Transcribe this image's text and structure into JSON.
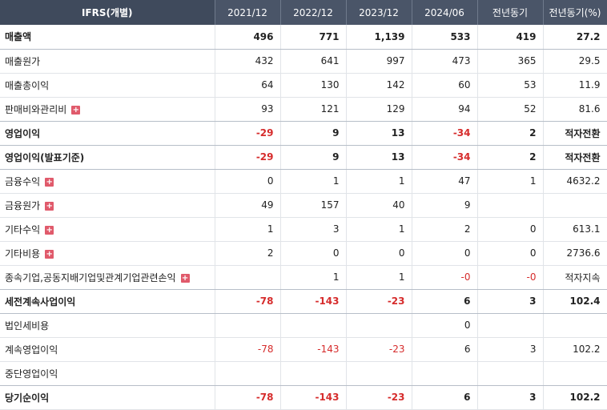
{
  "header": [
    "IFRS(개별)",
    "2021/12",
    "2022/12",
    "2023/12",
    "2024/06",
    "전년동기",
    "전년동기(%)"
  ],
  "rows": [
    {
      "label": "매출액",
      "bold": true,
      "expand": false,
      "cells": [
        "496",
        "771",
        "1,139",
        "533",
        "419",
        "27.2"
      ],
      "neg": [
        false,
        false,
        false,
        false,
        false,
        false
      ]
    },
    {
      "label": "매출원가",
      "bold": false,
      "expand": false,
      "cells": [
        "432",
        "641",
        "997",
        "473",
        "365",
        "29.5"
      ],
      "neg": [
        false,
        false,
        false,
        false,
        false,
        false
      ]
    },
    {
      "label": "매출총이익",
      "bold": false,
      "expand": false,
      "cells": [
        "64",
        "130",
        "142",
        "60",
        "53",
        "11.9"
      ],
      "neg": [
        false,
        false,
        false,
        false,
        false,
        false
      ]
    },
    {
      "label": "판매비와관리비",
      "bold": false,
      "expand": true,
      "cells": [
        "93",
        "121",
        "129",
        "94",
        "52",
        "81.6"
      ],
      "neg": [
        false,
        false,
        false,
        false,
        false,
        false
      ]
    },
    {
      "label": "영업이익",
      "bold": true,
      "expand": false,
      "cells": [
        "-29",
        "9",
        "13",
        "-34",
        "2",
        "적자전환"
      ],
      "neg": [
        true,
        false,
        false,
        true,
        false,
        false
      ]
    },
    {
      "label": "영업이익(발표기준)",
      "bold": true,
      "expand": false,
      "cells": [
        "-29",
        "9",
        "13",
        "-34",
        "2",
        "적자전환"
      ],
      "neg": [
        true,
        false,
        false,
        true,
        false,
        false
      ]
    },
    {
      "label": "금융수익",
      "bold": false,
      "expand": true,
      "cells": [
        "0",
        "1",
        "1",
        "47",
        "1",
        "4632.2"
      ],
      "neg": [
        false,
        false,
        false,
        false,
        false,
        false
      ]
    },
    {
      "label": "금융원가",
      "bold": false,
      "expand": true,
      "cells": [
        "49",
        "157",
        "40",
        "9",
        "",
        ""
      ],
      "neg": [
        false,
        false,
        false,
        false,
        false,
        false
      ]
    },
    {
      "label": "기타수익",
      "bold": false,
      "expand": true,
      "cells": [
        "1",
        "3",
        "1",
        "2",
        "0",
        "613.1"
      ],
      "neg": [
        false,
        false,
        false,
        false,
        false,
        false
      ]
    },
    {
      "label": "기타비용",
      "bold": false,
      "expand": true,
      "cells": [
        "2",
        "0",
        "0",
        "0",
        "0",
        "2736.6"
      ],
      "neg": [
        false,
        false,
        false,
        false,
        false,
        false
      ]
    },
    {
      "label": "종속기업,공동지배기업및관계기업관련손익",
      "bold": false,
      "expand": true,
      "cells": [
        "",
        "1",
        "1",
        "-0",
        "-0",
        "적자지속"
      ],
      "neg": [
        false,
        false,
        false,
        true,
        true,
        false
      ]
    },
    {
      "label": "세전계속사업이익",
      "bold": true,
      "expand": false,
      "cells": [
        "-78",
        "-143",
        "-23",
        "6",
        "3",
        "102.4"
      ],
      "neg": [
        true,
        true,
        true,
        false,
        false,
        false
      ]
    },
    {
      "label": "법인세비용",
      "bold": false,
      "expand": false,
      "cells": [
        "",
        "",
        "",
        "0",
        "",
        ""
      ],
      "neg": [
        false,
        false,
        false,
        false,
        false,
        false
      ]
    },
    {
      "label": "계속영업이익",
      "bold": false,
      "expand": false,
      "cells": [
        "-78",
        "-143",
        "-23",
        "6",
        "3",
        "102.2"
      ],
      "neg": [
        true,
        true,
        true,
        false,
        false,
        false
      ]
    },
    {
      "label": "중단영업이익",
      "bold": false,
      "expand": false,
      "cells": [
        "",
        "",
        "",
        "",
        "",
        ""
      ],
      "neg": [
        false,
        false,
        false,
        false,
        false,
        false
      ]
    },
    {
      "label": "당기순이익",
      "bold": true,
      "expand": false,
      "cells": [
        "-78",
        "-143",
        "-23",
        "6",
        "3",
        "102.2"
      ],
      "neg": [
        true,
        true,
        true,
        false,
        false,
        false
      ]
    }
  ],
  "separator_after": [
    0,
    3,
    4,
    5,
    10,
    11,
    14
  ]
}
